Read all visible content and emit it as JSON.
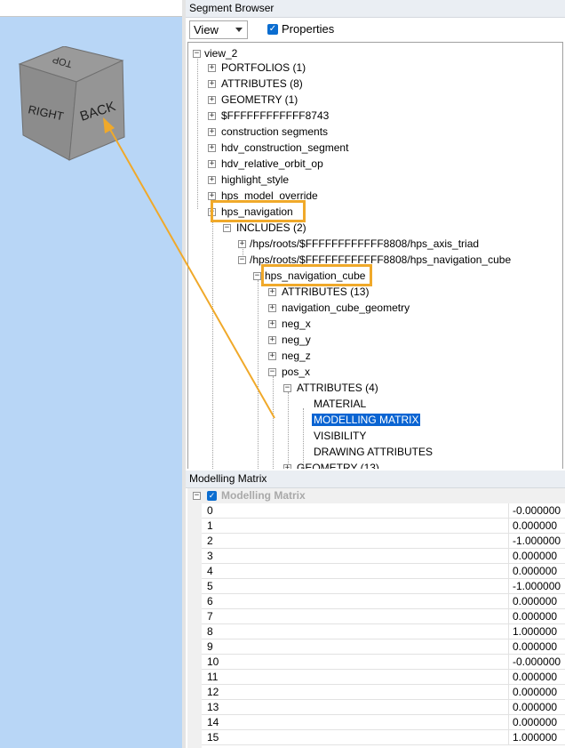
{
  "segment_browser": {
    "title": "Segment Browser",
    "view_select": "View",
    "properties_label": "Properties",
    "properties_checked": true,
    "tree": [
      {
        "label": "view_2"
      },
      {
        "label": "PORTFOLIOS (1)"
      },
      {
        "label": "ATTRIBUTES (8)"
      },
      {
        "label": "GEOMETRY (1)"
      },
      {
        "label": "$FFFFFFFFFFFF8743"
      },
      {
        "label": "construction segments"
      },
      {
        "label": "hdv_construction_segment"
      },
      {
        "label": "hdv_relative_orbit_op"
      },
      {
        "label": "highlight_style"
      },
      {
        "label": "hps_model_override"
      },
      {
        "label": "hps_navigation"
      },
      {
        "label": "INCLUDES (2)"
      },
      {
        "label": "/hps/roots/$FFFFFFFFFFFF8808/hps_axis_triad"
      },
      {
        "label": "/hps/roots/$FFFFFFFFFFFF8808/hps_navigation_cube"
      },
      {
        "label": "hps_navigation_cube"
      },
      {
        "label": "ATTRIBUTES (13)"
      },
      {
        "label": "navigation_cube_geometry"
      },
      {
        "label": "neg_x"
      },
      {
        "label": "neg_y"
      },
      {
        "label": "neg_z"
      },
      {
        "label": "pos_x"
      },
      {
        "label": "ATTRIBUTES (4)"
      },
      {
        "label": "MATERIAL"
      },
      {
        "label": "MODELLING MATRIX"
      },
      {
        "label": "VISIBILITY"
      },
      {
        "label": "DRAWING ATTRIBUTES"
      },
      {
        "label": "GEOMETRY (13)"
      }
    ]
  },
  "modelling_matrix": {
    "title": "Modelling Matrix",
    "header_label": "Modelling Matrix",
    "rows": [
      {
        "key": "0",
        "value": "-0.000000"
      },
      {
        "key": "1",
        "value": "0.000000"
      },
      {
        "key": "2",
        "value": "-1.000000"
      },
      {
        "key": "3",
        "value": "0.000000"
      },
      {
        "key": "4",
        "value": "0.000000"
      },
      {
        "key": "5",
        "value": "-1.000000"
      },
      {
        "key": "6",
        "value": "0.000000"
      },
      {
        "key": "7",
        "value": "0.000000"
      },
      {
        "key": "8",
        "value": "1.000000"
      },
      {
        "key": "9",
        "value": "0.000000"
      },
      {
        "key": "10",
        "value": "-0.000000"
      },
      {
        "key": "11",
        "value": "0.000000"
      },
      {
        "key": "12",
        "value": "0.000000"
      },
      {
        "key": "13",
        "value": "0.000000"
      },
      {
        "key": "14",
        "value": "0.000000"
      },
      {
        "key": "15",
        "value": "1.000000"
      }
    ]
  },
  "nav_cube": {
    "top": "TOP",
    "right": "RIGHT",
    "back": "BACK"
  },
  "colors": {
    "viewport_bg": "#b8d6f6",
    "highlight": "#f0a92a",
    "selection": "#0a64d2"
  }
}
